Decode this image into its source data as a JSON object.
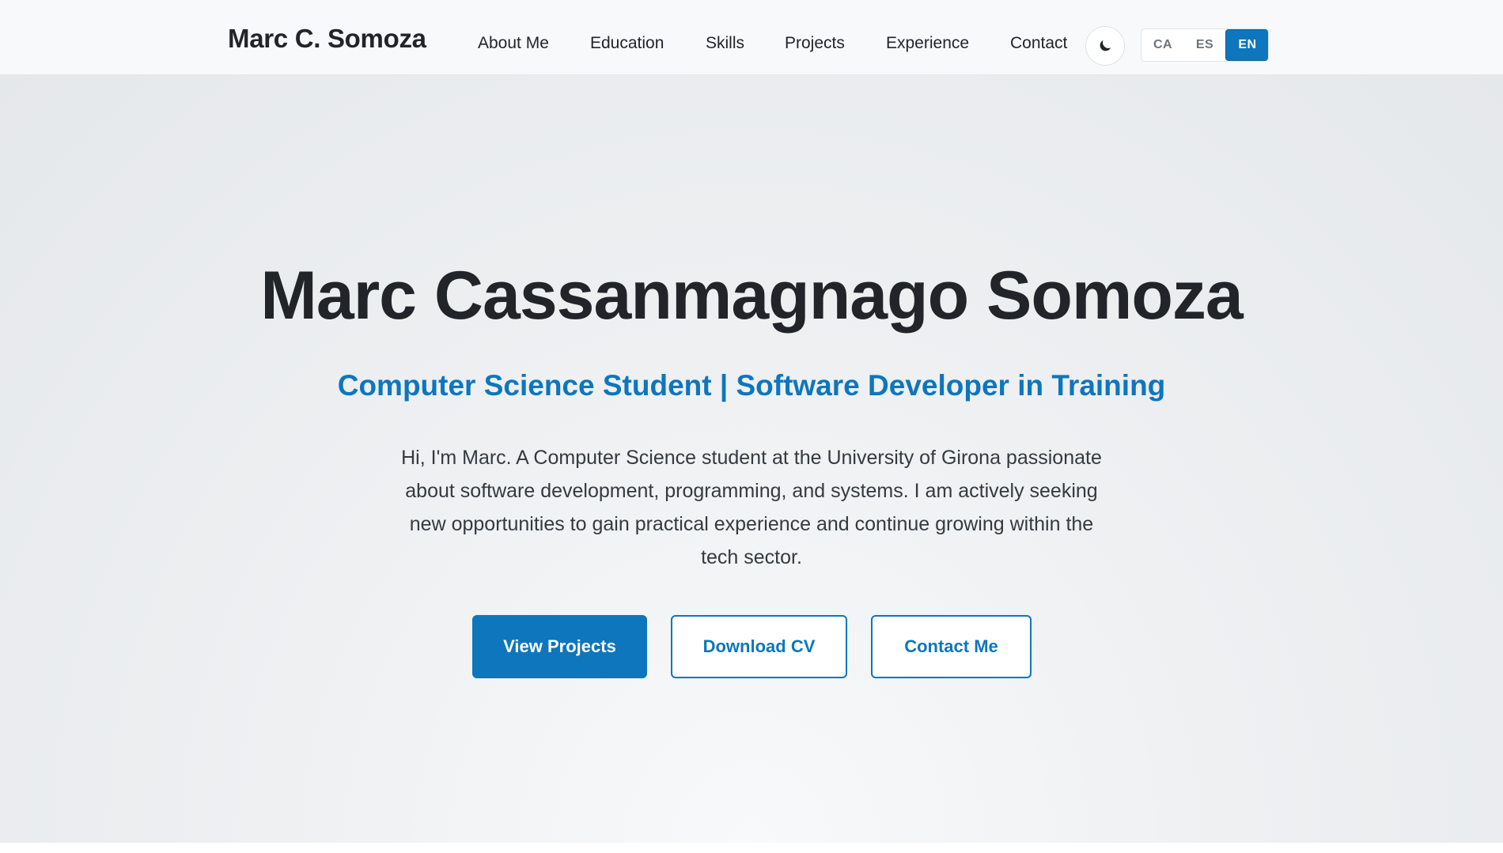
{
  "header": {
    "brand": "Marc C. Somoza",
    "nav": [
      {
        "label": "About Me"
      },
      {
        "label": "Education"
      },
      {
        "label": "Skills"
      },
      {
        "label": "Projects"
      },
      {
        "label": "Experience"
      },
      {
        "label": "Contact"
      }
    ],
    "theme_toggle_icon": "moon-icon",
    "languages": [
      {
        "code": "CA",
        "active": false
      },
      {
        "code": "ES",
        "active": false
      },
      {
        "code": "EN",
        "active": true
      }
    ]
  },
  "hero": {
    "title": "Marc Cassanmagnago Somoza",
    "subtitle": "Computer Science Student | Software Developer in Training",
    "bio": "Hi, I'm Marc. A Computer Science student at the University of Girona passionate about software development, programming, and systems. I am actively seeking new opportunities to gain practical experience and continue growing within the tech sector.",
    "buttons": {
      "primary": "View Projects",
      "cv": "Download CV",
      "contact": "Contact Me"
    }
  },
  "colors": {
    "accent": "#0d76bd",
    "text": "#212529",
    "header_bg": "#f8f9fa"
  }
}
